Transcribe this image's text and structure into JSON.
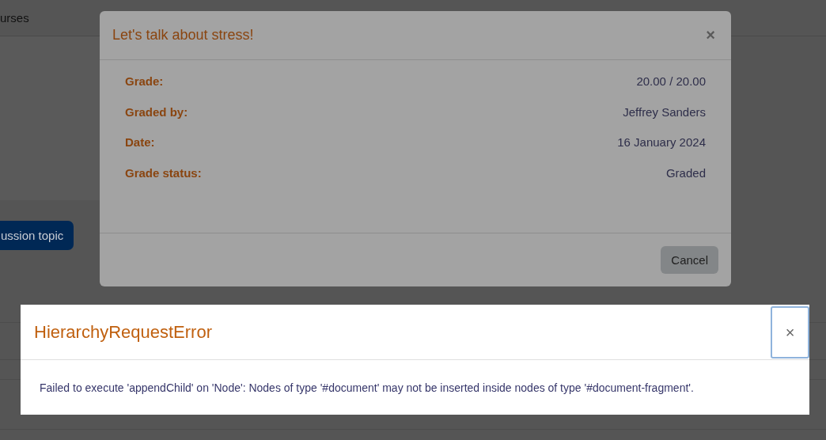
{
  "page": {
    "nav_text": "urses",
    "action_button": "ussion topic"
  },
  "modal": {
    "title": "Let's talk about stress!",
    "close": "×",
    "fields": [
      {
        "label": "Grade:",
        "value": "20.00 / 20.00"
      },
      {
        "label": "Graded by:",
        "value": "Jeffrey Sanders"
      },
      {
        "label": "Date:",
        "value": "16 January 2024"
      },
      {
        "label": "Grade status:",
        "value": "Graded"
      }
    ],
    "buttons": [
      "Cancel"
    ]
  },
  "error": {
    "title": "HierarchyRequestError",
    "close": {
      "label": "×",
      "focused": true
    },
    "message": "Failed to execute 'appendChild' on 'Node': Nodes of type '#document' may not be inserted inside nodes of type '#document-fragment'."
  }
}
